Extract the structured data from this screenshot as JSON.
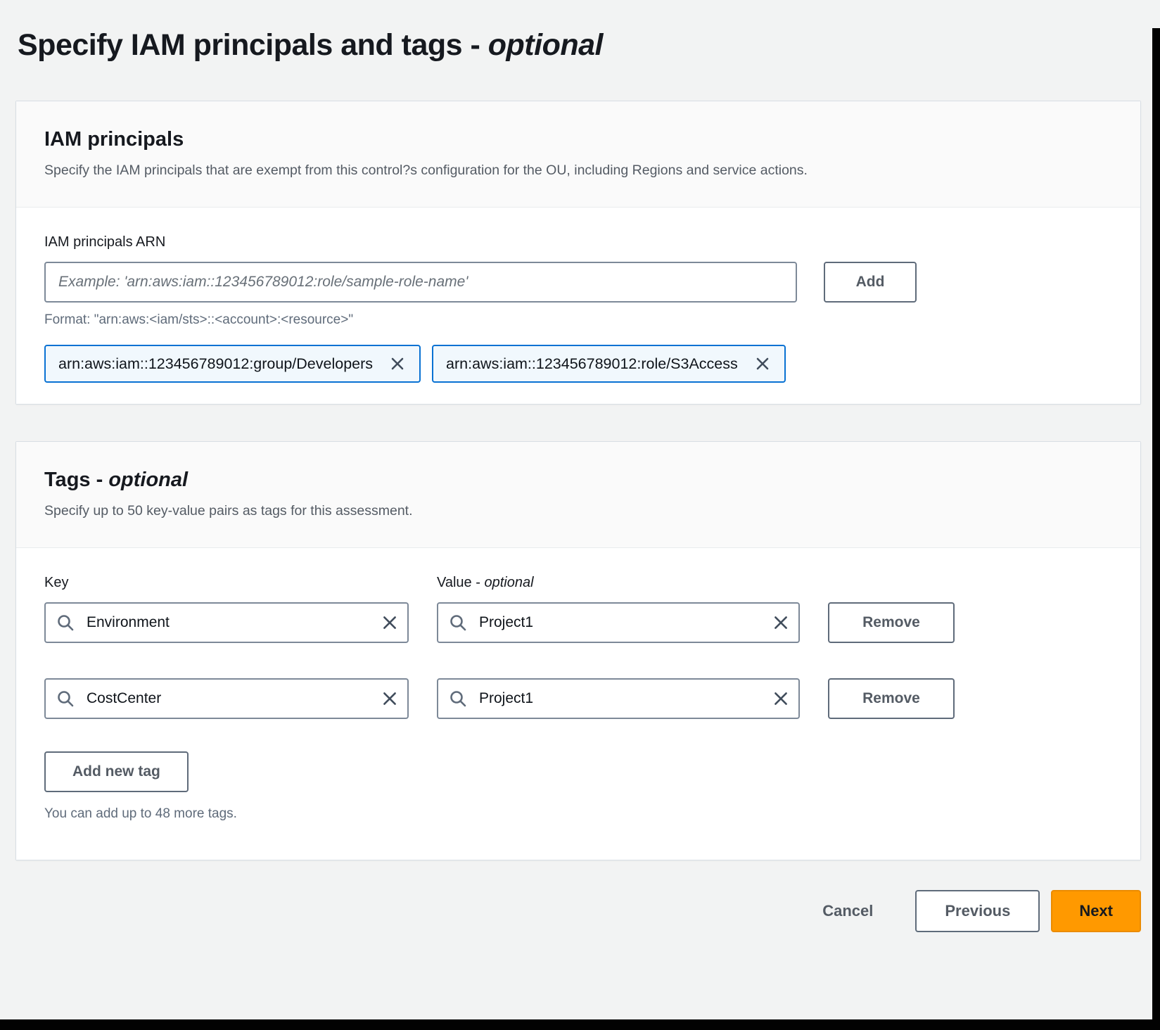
{
  "page": {
    "title_main": "Specify IAM principals and tags",
    "title_sep": " - ",
    "title_optional": "optional"
  },
  "iam_card": {
    "heading": "IAM principals",
    "description": "Specify the IAM principals that are exempt from this control?s configuration for the OU, including Regions and service actions.",
    "arn_label": "IAM principals ARN",
    "arn_placeholder": "Example: 'arn:aws:iam::123456789012:role/sample-role-name'",
    "add_button": "Add",
    "format_hint": "Format: \"arn:aws:<iam/sts>::<account>:<resource>\"",
    "tokens": [
      {
        "label": "arn:aws:iam::123456789012:group/Developers"
      },
      {
        "label": "arn:aws:iam::123456789012:role/S3Access"
      }
    ]
  },
  "tags_card": {
    "heading_main": "Tags",
    "heading_sep": " - ",
    "heading_optional": "optional",
    "description": "Specify up to 50 key-value pairs as tags for this assessment.",
    "key_label": "Key",
    "value_label_main": "Value",
    "value_label_sep": " - ",
    "value_label_optional": "optional",
    "rows": [
      {
        "key": "Environment",
        "value": "Project1",
        "remove_label": "Remove"
      },
      {
        "key": "CostCenter",
        "value": "Project1",
        "remove_label": "Remove"
      }
    ],
    "add_new_tag_button": "Add new tag",
    "remaining_hint": "You can add up to 48 more tags."
  },
  "footer": {
    "cancel": "Cancel",
    "previous": "Previous",
    "next": "Next"
  },
  "colors": {
    "accent_orange": "#ff9900",
    "token_border_blue": "#0972d3",
    "token_bg_blue": "#f1f8fd",
    "page_bg": "#f2f3f3"
  }
}
